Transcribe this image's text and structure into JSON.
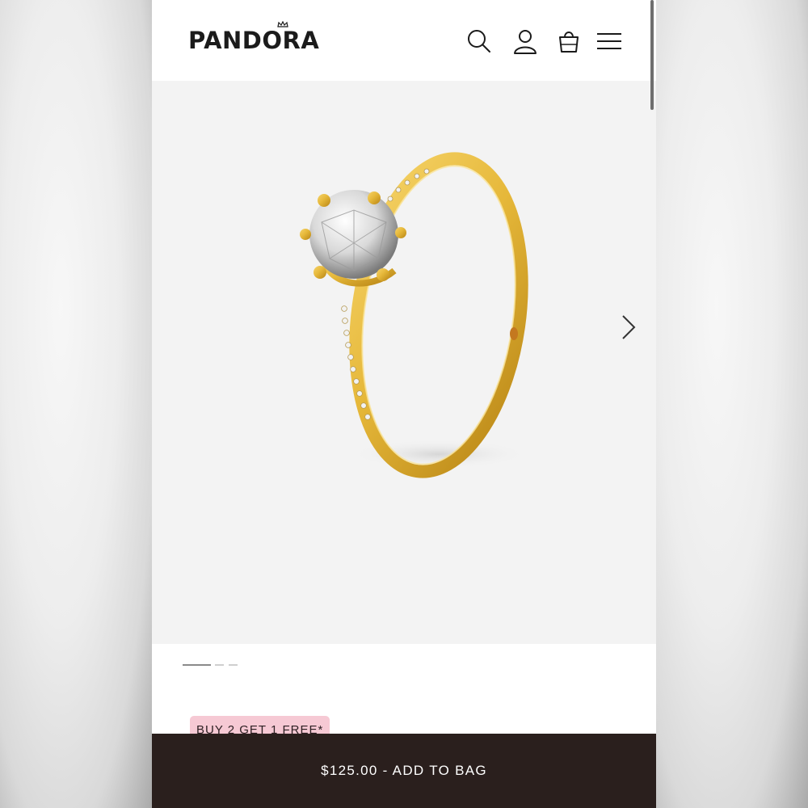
{
  "brand": {
    "logo_text": "PANDORA"
  },
  "header": {
    "icons": [
      "search-icon",
      "account-icon",
      "shopping-bag-icon",
      "menu-icon"
    ]
  },
  "product": {
    "image_alt": "Gold-plated sparkling crown solitaire ring",
    "gallery_count": 3,
    "gallery_active": 0
  },
  "promo": {
    "label": "BUY 2 GET 1 FREE*"
  },
  "buy_bar": {
    "label": "$125.00 - ADD TO BAG"
  },
  "colors": {
    "header_bg": "#ffffff",
    "hero_bg": "#f3f3f3",
    "promo_bg": "#f6c9d4",
    "buy_bar_bg": "#2a1f1d",
    "ring_gold": "#e6b83a"
  }
}
